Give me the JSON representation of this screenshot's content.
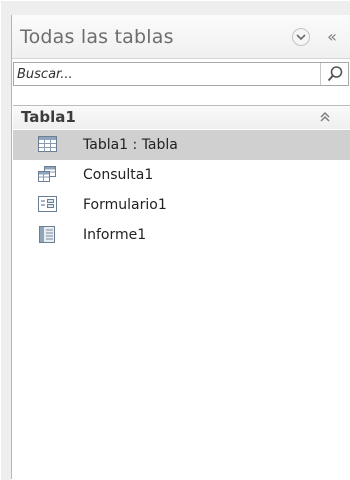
{
  "pane": {
    "title": "Todas las tablas",
    "dropdown_icon": "chevron-down-icon",
    "collapse_icon": "double-chevron-left-icon",
    "collapse_glyph": "«"
  },
  "search": {
    "placeholder": "Buscar...",
    "value": "",
    "icon": "search-icon"
  },
  "group": {
    "title": "Tabla1",
    "collapse_icon": "double-chevron-up-icon"
  },
  "items": [
    {
      "label": "Tabla1 : Tabla",
      "icon": "table-icon",
      "selected": true
    },
    {
      "label": "Consulta1",
      "icon": "query-icon",
      "selected": false
    },
    {
      "label": "Formulario1",
      "icon": "form-icon",
      "selected": false
    },
    {
      "label": "Informe1",
      "icon": "report-icon",
      "selected": false
    }
  ],
  "colors": {
    "selection": "#d0d0d0",
    "header_text": "#6d6d6d",
    "border": "#b6b6b6"
  }
}
